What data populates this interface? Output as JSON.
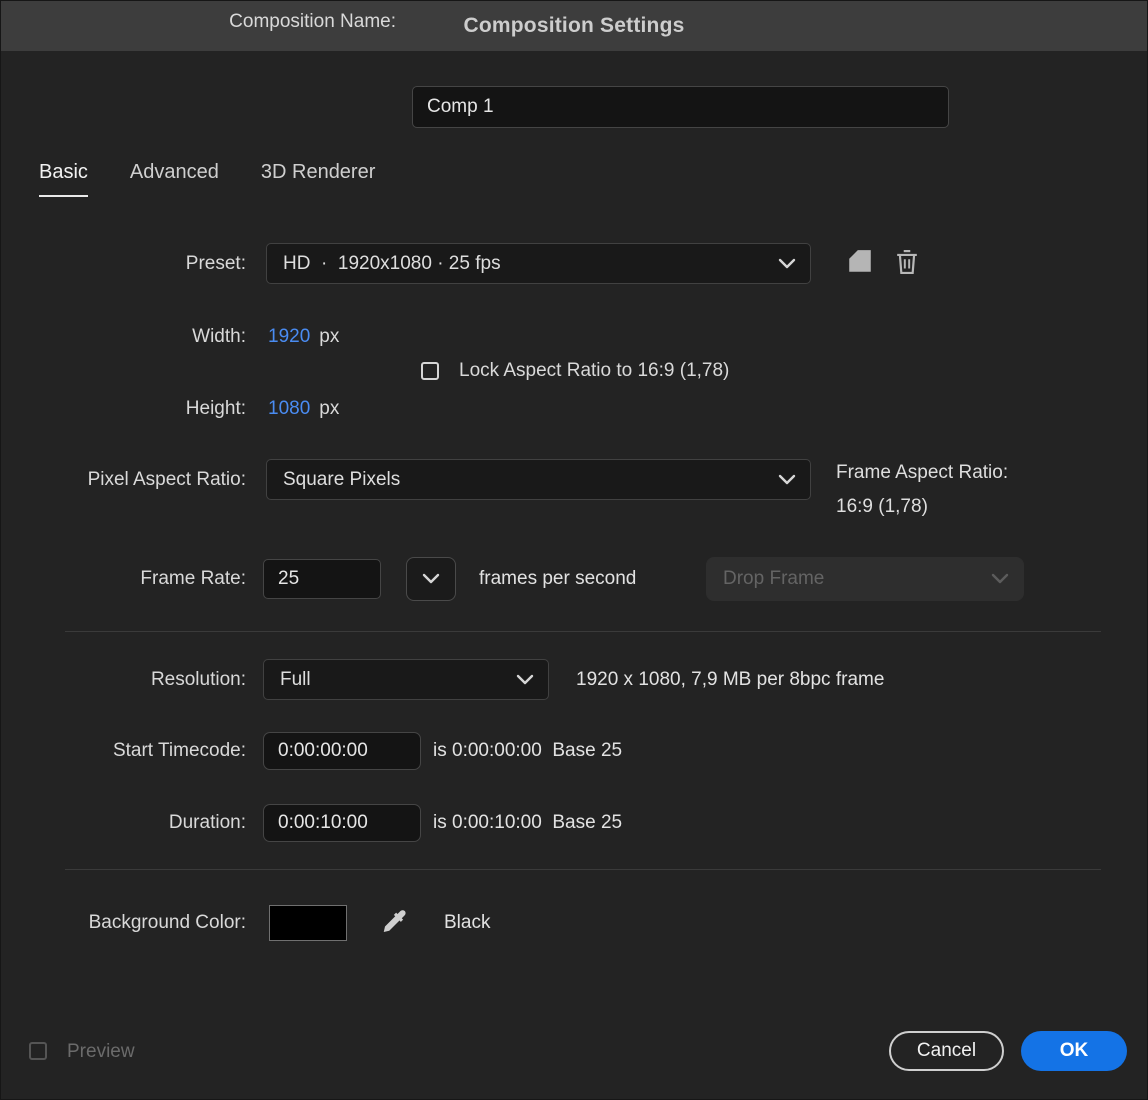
{
  "colors": {
    "dialog_background": "#232323",
    "titlebar_background": "#3d3d3d",
    "dimension_value_blue": "#4a8cf2",
    "ok_button_blue": "#1473e6"
  },
  "icons": {
    "dropdown": "chevron-down",
    "preset_save": "save-preset",
    "preset_delete": "trash",
    "background_picker": "eyedropper"
  },
  "titlebar": {
    "title": "Composition Settings"
  },
  "name_row": {
    "label": "Composition Name:",
    "value": "Comp 1"
  },
  "tabs": {
    "items": [
      {
        "label": "Basic",
        "active": true
      },
      {
        "label": "Advanced",
        "active": false
      },
      {
        "label": "3D Renderer",
        "active": false
      }
    ]
  },
  "preset": {
    "label": "Preset:",
    "value": "HD  ·  1920x1080 · 25 fps"
  },
  "dims": {
    "width_label": "Width:",
    "width_value": "1920",
    "width_unit": "px",
    "height_label": "Height:",
    "height_value": "1080",
    "height_unit": "px",
    "lock_label": "Lock Aspect Ratio to 16:9 (1,78)",
    "lock_checked": false
  },
  "pixel_aspect": {
    "label": "Pixel Aspect Ratio:",
    "value": "Square Pixels",
    "frame_label": "Frame Aspect Ratio:",
    "frame_value": "16:9 (1,78)"
  },
  "frame_rate": {
    "label": "Frame Rate:",
    "value": "25",
    "suffix": "frames per second",
    "drop_frame": "Drop Frame",
    "drop_frame_enabled": false
  },
  "resolution": {
    "label": "Resolution:",
    "value": "Full",
    "info": "1920 x 1080, 7,9 MB per 8bpc frame"
  },
  "start_timecode": {
    "label": "Start Timecode:",
    "value": "0:00:00:00",
    "info": "is 0:00:00:00  Base 25"
  },
  "duration": {
    "label": "Duration:",
    "value": "0:00:10:00",
    "info": "is 0:00:10:00  Base 25"
  },
  "background": {
    "label": "Background Color:",
    "swatch_color": "#000000",
    "name": "Black"
  },
  "footer": {
    "preview_label": "Preview",
    "preview_checked": false,
    "cancel_label": "Cancel",
    "ok_label": "OK"
  }
}
